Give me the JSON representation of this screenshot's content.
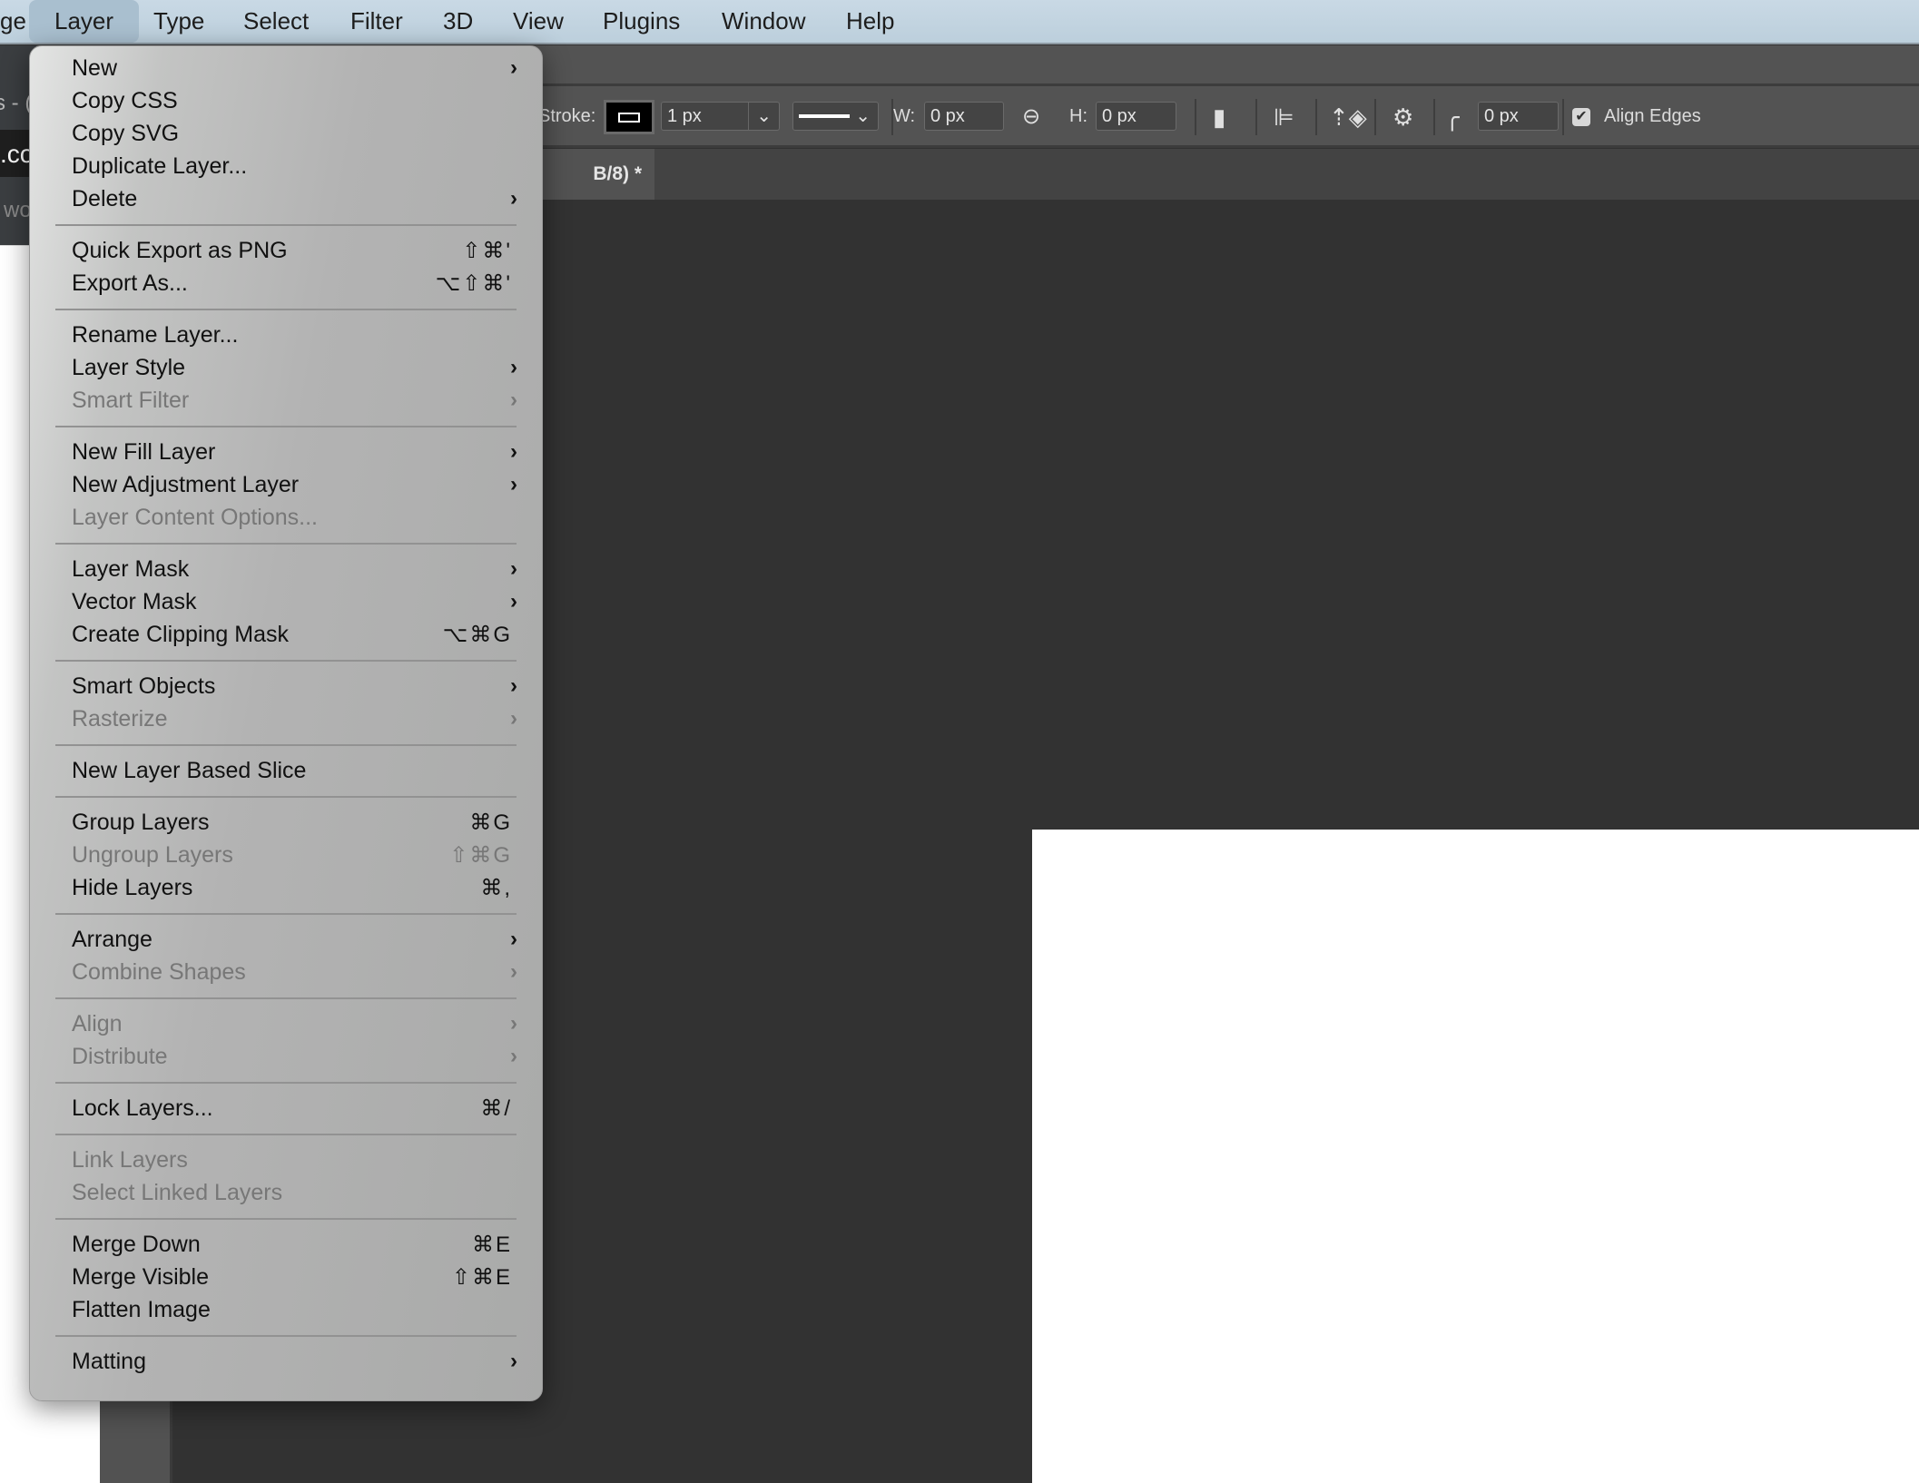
{
  "menubar": {
    "items": [
      {
        "label": "ge"
      },
      {
        "label": "Layer",
        "active": true
      },
      {
        "label": "Type"
      },
      {
        "label": "Select"
      },
      {
        "label": "Filter"
      },
      {
        "label": "3D"
      },
      {
        "label": "View"
      },
      {
        "label": "Plugins"
      },
      {
        "label": "Window"
      },
      {
        "label": "Help"
      }
    ]
  },
  "background_window": {
    "line1": "s - (",
    "line2": ".co",
    "line3": "wo"
  },
  "options_bar": {
    "stroke_label": "Stroke:",
    "stroke_width": "1 px",
    "w_label": "W:",
    "w_value": "0 px",
    "h_label": "H:",
    "h_value": "0 px",
    "radius_value": "0 px",
    "align_edges_label": "Align Edges",
    "align_edges_checked": true
  },
  "document_tab": {
    "title": "B/8) *"
  },
  "layer_menu": {
    "groups": [
      [
        {
          "label": "New",
          "submenu": true
        },
        {
          "label": "Copy CSS"
        },
        {
          "label": "Copy SVG"
        },
        {
          "label": "Duplicate Layer..."
        },
        {
          "label": "Delete",
          "submenu": true
        }
      ],
      [
        {
          "label": "Quick Export as PNG",
          "shortcut": "⇧⌘'"
        },
        {
          "label": "Export As...",
          "shortcut": "⌥⇧⌘'"
        }
      ],
      [
        {
          "label": "Rename Layer..."
        },
        {
          "label": "Layer Style",
          "submenu": true
        },
        {
          "label": "Smart Filter",
          "submenu": true,
          "disabled": true
        }
      ],
      [
        {
          "label": "New Fill Layer",
          "submenu": true
        },
        {
          "label": "New Adjustment Layer",
          "submenu": true
        },
        {
          "label": "Layer Content Options...",
          "disabled": true
        }
      ],
      [
        {
          "label": "Layer Mask",
          "submenu": true
        },
        {
          "label": "Vector Mask",
          "submenu": true
        },
        {
          "label": "Create Clipping Mask",
          "shortcut": "⌥⌘G"
        }
      ],
      [
        {
          "label": "Smart Objects",
          "submenu": true
        },
        {
          "label": "Rasterize",
          "submenu": true,
          "disabled": true
        }
      ],
      [
        {
          "label": "New Layer Based Slice"
        }
      ],
      [
        {
          "label": "Group Layers",
          "shortcut": "⌘G"
        },
        {
          "label": "Ungroup Layers",
          "shortcut": "⇧⌘G",
          "disabled": true
        },
        {
          "label": "Hide Layers",
          "shortcut": "⌘,"
        }
      ],
      [
        {
          "label": "Arrange",
          "submenu": true
        },
        {
          "label": "Combine Shapes",
          "submenu": true,
          "disabled": true
        }
      ],
      [
        {
          "label": "Align",
          "submenu": true,
          "disabled": true
        },
        {
          "label": "Distribute",
          "submenu": true,
          "disabled": true
        }
      ],
      [
        {
          "label": "Lock Layers...",
          "shortcut": "⌘/"
        }
      ],
      [
        {
          "label": "Link Layers",
          "disabled": true
        },
        {
          "label": "Select Linked Layers",
          "disabled": true
        }
      ],
      [
        {
          "label": "Merge Down",
          "shortcut": "⌘E"
        },
        {
          "label": "Merge Visible",
          "shortcut": "⇧⌘E"
        },
        {
          "label": "Flatten Image"
        }
      ],
      [
        {
          "label": "Matting",
          "submenu": true
        }
      ]
    ]
  }
}
